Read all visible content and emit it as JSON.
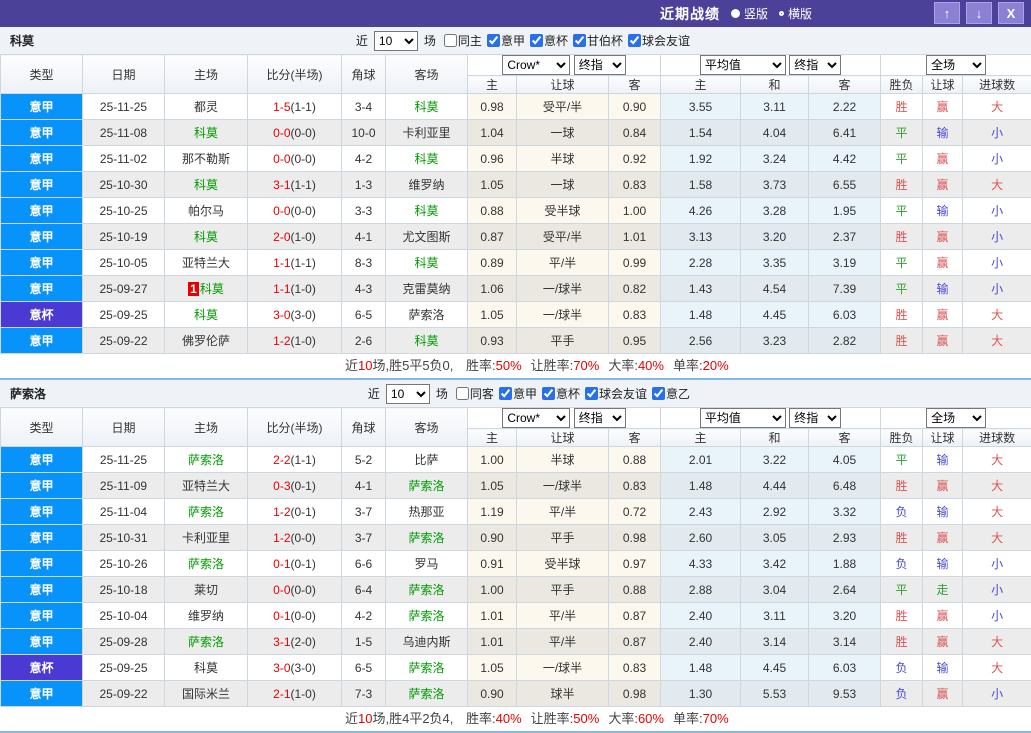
{
  "titlebar": {
    "title": "近期战绩",
    "radios": [
      {
        "label": "竖版",
        "selected": true
      },
      {
        "label": "横版",
        "selected": false
      }
    ],
    "buttons": {
      "up": "↑",
      "down": "↓",
      "close": "X"
    },
    "bar_color": "#4c4199"
  },
  "columns": {
    "left": [
      "类型",
      "日期",
      "主场",
      "比分(半场)",
      "角球",
      "客场"
    ],
    "handicap": [
      "主",
      "让球",
      "客"
    ],
    "average": [
      "主",
      "和",
      "客"
    ],
    "result": [
      "胜负",
      "让球",
      "进球数"
    ]
  },
  "type_colors": {
    "意甲": "#0893fb",
    "意杯": "#4b39d3"
  },
  "result_colors": {
    "red": "#dd5252",
    "green": "#2f9e2f",
    "blue": "#4949d5"
  },
  "sections": [
    {
      "team": "科莫",
      "filter": {
        "prefix": "近",
        "count": "10",
        "suffix": "场",
        "checks": [
          {
            "label": "同主",
            "checked": false
          },
          {
            "label": "意甲",
            "checked": true
          },
          {
            "label": "意杯",
            "checked": true
          },
          {
            "label": "甘伯杯",
            "checked": true
          },
          {
            "label": "球会友谊",
            "checked": true
          }
        ]
      },
      "selects": {
        "book": "Crow*",
        "book_time": "终指",
        "avg": "平均值",
        "avg_time": "终指",
        "scope": "全场"
      },
      "rows": [
        {
          "lg": "意甲",
          "date": "25-11-25",
          "home": "都灵",
          "hf": false,
          "badge": "",
          "ft": "1-5",
          "ht": "(1-1)",
          "cn": "3-4",
          "away": "科莫",
          "af": true,
          "oh": "0.98",
          "line": "受平/半",
          "oa": "0.90",
          "ah": "3.55",
          "ad": "3.11",
          "aa": "2.22",
          "r1": "胜",
          "r2": "赢",
          "r3": "大"
        },
        {
          "lg": "意甲",
          "date": "25-11-08",
          "home": "科莫",
          "hf": true,
          "badge": "",
          "ft": "0-0",
          "ht": "(0-0)",
          "cn": "10-0",
          "away": "卡利亚里",
          "af": false,
          "oh": "1.04",
          "line": "一球",
          "oa": "0.84",
          "ah": "1.54",
          "ad": "4.04",
          "aa": "6.41",
          "r1": "平",
          "r2": "输",
          "r3": "小"
        },
        {
          "lg": "意甲",
          "date": "25-11-02",
          "home": "那不勒斯",
          "hf": false,
          "badge": "",
          "ft": "0-0",
          "ht": "(0-0)",
          "cn": "4-2",
          "away": "科莫",
          "af": true,
          "oh": "0.96",
          "line": "半球",
          "oa": "0.92",
          "ah": "1.92",
          "ad": "3.24",
          "aa": "4.42",
          "r1": "平",
          "r2": "赢",
          "r3": "小"
        },
        {
          "lg": "意甲",
          "date": "25-10-30",
          "home": "科莫",
          "hf": true,
          "badge": "",
          "ft": "3-1",
          "ht": "(1-1)",
          "cn": "1-3",
          "away": "维罗纳",
          "af": false,
          "oh": "1.05",
          "line": "一球",
          "oa": "0.83",
          "ah": "1.58",
          "ad": "3.73",
          "aa": "6.55",
          "r1": "胜",
          "r2": "赢",
          "r3": "大"
        },
        {
          "lg": "意甲",
          "date": "25-10-25",
          "home": "帕尔马",
          "hf": false,
          "badge": "",
          "ft": "0-0",
          "ht": "(0-0)",
          "cn": "3-3",
          "away": "科莫",
          "af": true,
          "oh": "0.88",
          "line": "受半球",
          "oa": "1.00",
          "ah": "4.26",
          "ad": "3.28",
          "aa": "1.95",
          "r1": "平",
          "r2": "输",
          "r3": "小"
        },
        {
          "lg": "意甲",
          "date": "25-10-19",
          "home": "科莫",
          "hf": true,
          "badge": "",
          "ft": "2-0",
          "ht": "(1-0)",
          "cn": "4-1",
          "away": "尤文图斯",
          "af": false,
          "oh": "0.87",
          "line": "受平/半",
          "oa": "1.01",
          "ah": "3.13",
          "ad": "3.20",
          "aa": "2.37",
          "r1": "胜",
          "r2": "赢",
          "r3": "小"
        },
        {
          "lg": "意甲",
          "date": "25-10-05",
          "home": "亚特兰大",
          "hf": false,
          "badge": "",
          "ft": "1-1",
          "ht": "(1-1)",
          "cn": "8-3",
          "away": "科莫",
          "af": true,
          "oh": "0.89",
          "line": "平/半",
          "oa": "0.99",
          "ah": "2.28",
          "ad": "3.35",
          "aa": "3.19",
          "r1": "平",
          "r2": "赢",
          "r3": "小"
        },
        {
          "lg": "意甲",
          "date": "25-09-27",
          "home": "科莫",
          "hf": true,
          "badge": "1",
          "ft": "1-1",
          "ht": "(1-0)",
          "cn": "4-3",
          "away": "克雷莫纳",
          "af": false,
          "oh": "1.06",
          "line": "一/球半",
          "oa": "0.82",
          "ah": "1.43",
          "ad": "4.54",
          "aa": "7.39",
          "r1": "平",
          "r2": "输",
          "r3": "小"
        },
        {
          "lg": "意杯",
          "date": "25-09-25",
          "home": "科莫",
          "hf": true,
          "badge": "",
          "ft": "3-0",
          "ht": "(3-0)",
          "cn": "6-5",
          "away": "萨索洛",
          "af": false,
          "oh": "1.05",
          "line": "一/球半",
          "oa": "0.83",
          "ah": "1.48",
          "ad": "4.45",
          "aa": "6.03",
          "r1": "胜",
          "r2": "赢",
          "r3": "大"
        },
        {
          "lg": "意甲",
          "date": "25-09-22",
          "home": "佛罗伦萨",
          "hf": false,
          "badge": "",
          "ft": "1-2",
          "ht": "(1-0)",
          "cn": "2-6",
          "away": "科莫",
          "af": true,
          "oh": "0.93",
          "line": "平手",
          "oa": "0.95",
          "ah": "2.56",
          "ad": "3.23",
          "aa": "2.82",
          "r1": "胜",
          "r2": "赢",
          "r3": "大"
        }
      ],
      "summary": {
        "prefix": "近",
        "count": "10",
        "mid": "场,胜5平5负0, ",
        "stats": [
          [
            "胜率:",
            "50%"
          ],
          [
            "让胜率:",
            "70%"
          ],
          [
            "大率:",
            "40%"
          ],
          [
            "单率:",
            "20%"
          ]
        ]
      }
    },
    {
      "team": "萨索洛",
      "filter": {
        "prefix": "近",
        "count": "10",
        "suffix": "场",
        "checks": [
          {
            "label": "同客",
            "checked": false
          },
          {
            "label": "意甲",
            "checked": true
          },
          {
            "label": "意杯",
            "checked": true
          },
          {
            "label": "球会友谊",
            "checked": true
          },
          {
            "label": "意乙",
            "checked": true
          }
        ]
      },
      "selects": {
        "book": "Crow*",
        "book_time": "终指",
        "avg": "平均值",
        "avg_time": "终指",
        "scope": "全场"
      },
      "rows": [
        {
          "lg": "意甲",
          "date": "25-11-25",
          "home": "萨索洛",
          "hf": true,
          "badge": "",
          "ft": "2-2",
          "ht": "(1-1)",
          "cn": "5-2",
          "away": "比萨",
          "af": false,
          "oh": "1.00",
          "line": "半球",
          "oa": "0.88",
          "ah": "2.01",
          "ad": "3.22",
          "aa": "4.05",
          "r1": "平",
          "r2": "输",
          "r3": "大"
        },
        {
          "lg": "意甲",
          "date": "25-11-09",
          "home": "亚特兰大",
          "hf": false,
          "badge": "",
          "ft": "0-3",
          "ht": "(0-1)",
          "cn": "4-1",
          "away": "萨索洛",
          "af": true,
          "oh": "1.05",
          "line": "一/球半",
          "oa": "0.83",
          "ah": "1.48",
          "ad": "4.44",
          "aa": "6.48",
          "r1": "胜",
          "r2": "赢",
          "r3": "大"
        },
        {
          "lg": "意甲",
          "date": "25-11-04",
          "home": "萨索洛",
          "hf": true,
          "badge": "",
          "ft": "1-2",
          "ht": "(0-1)",
          "cn": "3-7",
          "away": "热那亚",
          "af": false,
          "oh": "1.19",
          "line": "平/半",
          "oa": "0.72",
          "ah": "2.43",
          "ad": "2.92",
          "aa": "3.32",
          "r1": "负",
          "r2": "输",
          "r3": "大"
        },
        {
          "lg": "意甲",
          "date": "25-10-31",
          "home": "卡利亚里",
          "hf": false,
          "badge": "",
          "ft": "1-2",
          "ht": "(0-0)",
          "cn": "3-7",
          "away": "萨索洛",
          "af": true,
          "oh": "0.90",
          "line": "平手",
          "oa": "0.98",
          "ah": "2.60",
          "ad": "3.05",
          "aa": "2.93",
          "r1": "胜",
          "r2": "赢",
          "r3": "大"
        },
        {
          "lg": "意甲",
          "date": "25-10-26",
          "home": "萨索洛",
          "hf": true,
          "badge": "",
          "ft": "0-1",
          "ht": "(0-1)",
          "cn": "6-6",
          "away": "罗马",
          "af": false,
          "oh": "0.91",
          "line": "受半球",
          "oa": "0.97",
          "ah": "4.33",
          "ad": "3.42",
          "aa": "1.88",
          "r1": "负",
          "r2": "输",
          "r3": "小"
        },
        {
          "lg": "意甲",
          "date": "25-10-18",
          "home": "莱切",
          "hf": false,
          "badge": "",
          "ft": "0-0",
          "ht": "(0-0)",
          "cn": "6-4",
          "away": "萨索洛",
          "af": true,
          "oh": "1.00",
          "line": "平手",
          "oa": "0.88",
          "ah": "2.88",
          "ad": "3.04",
          "aa": "2.64",
          "r1": "平",
          "r2": "走",
          "r3": "小"
        },
        {
          "lg": "意甲",
          "date": "25-10-04",
          "home": "维罗纳",
          "hf": false,
          "badge": "",
          "ft": "0-1",
          "ht": "(0-0)",
          "cn": "4-2",
          "away": "萨索洛",
          "af": true,
          "oh": "1.01",
          "line": "平/半",
          "oa": "0.87",
          "ah": "2.40",
          "ad": "3.11",
          "aa": "3.20",
          "r1": "胜",
          "r2": "赢",
          "r3": "小"
        },
        {
          "lg": "意甲",
          "date": "25-09-28",
          "home": "萨索洛",
          "hf": true,
          "badge": "",
          "ft": "3-1",
          "ht": "(2-0)",
          "cn": "1-5",
          "away": "乌迪内斯",
          "af": false,
          "oh": "1.01",
          "line": "平/半",
          "oa": "0.87",
          "ah": "2.40",
          "ad": "3.14",
          "aa": "3.14",
          "r1": "胜",
          "r2": "赢",
          "r3": "大"
        },
        {
          "lg": "意杯",
          "date": "25-09-25",
          "home": "科莫",
          "hf": false,
          "badge": "",
          "ft": "3-0",
          "ht": "(3-0)",
          "cn": "6-5",
          "away": "萨索洛",
          "af": true,
          "oh": "1.05",
          "line": "一/球半",
          "oa": "0.83",
          "ah": "1.48",
          "ad": "4.45",
          "aa": "6.03",
          "r1": "负",
          "r2": "输",
          "r3": "大"
        },
        {
          "lg": "意甲",
          "date": "25-09-22",
          "home": "国际米兰",
          "hf": false,
          "badge": "",
          "ft": "2-1",
          "ht": "(1-0)",
          "cn": "7-3",
          "away": "萨索洛",
          "af": true,
          "oh": "0.90",
          "line": "球半",
          "oa": "0.98",
          "ah": "1.30",
          "ad": "5.53",
          "aa": "9.53",
          "r1": "负",
          "r2": "赢",
          "r3": "小"
        }
      ],
      "summary": {
        "prefix": "近",
        "count": "10",
        "mid": "场,胜4平2负4, ",
        "stats": [
          [
            "胜率:",
            "40%"
          ],
          [
            "让胜率:",
            "50%"
          ],
          [
            "大率:",
            "60%"
          ],
          [
            "单率:",
            "70%"
          ]
        ]
      }
    }
  ]
}
